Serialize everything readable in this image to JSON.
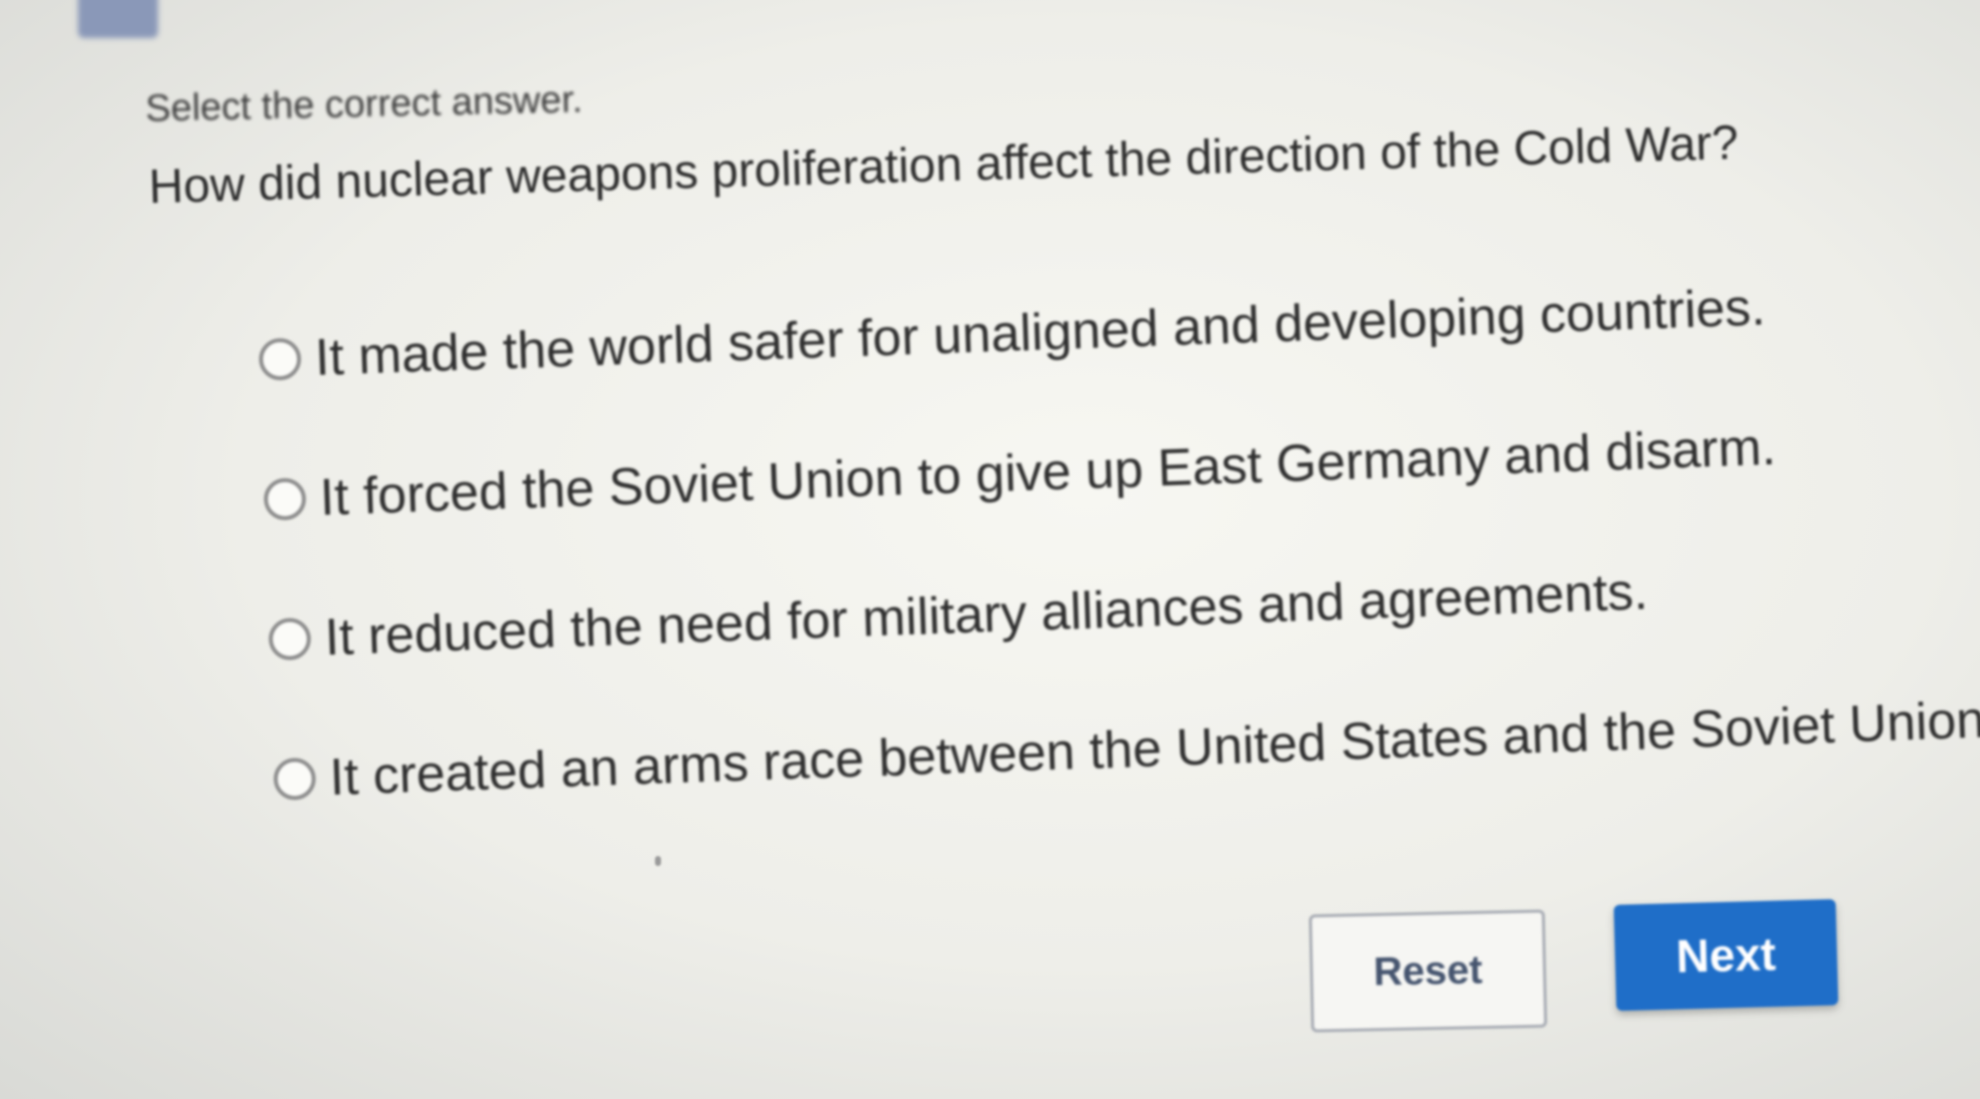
{
  "quiz": {
    "instruction": "Select the correct answer.",
    "question": "How did nuclear weapons proliferation affect the direction of the Cold War?",
    "options": [
      {
        "label": "It made the world safer for unaligned and developing countries."
      },
      {
        "label": "It forced the Soviet Union to give up East Germany and disarm."
      },
      {
        "label": "It reduced the need for military alliances and agreements."
      },
      {
        "label": "It created an arms race between the United States and the Soviet Union."
      }
    ]
  },
  "buttons": {
    "reset_label": "Reset",
    "next_label": "Next"
  },
  "colors": {
    "next_button": "#1f6ec8",
    "reset_text": "#46556f",
    "background": "#eeeee9"
  }
}
